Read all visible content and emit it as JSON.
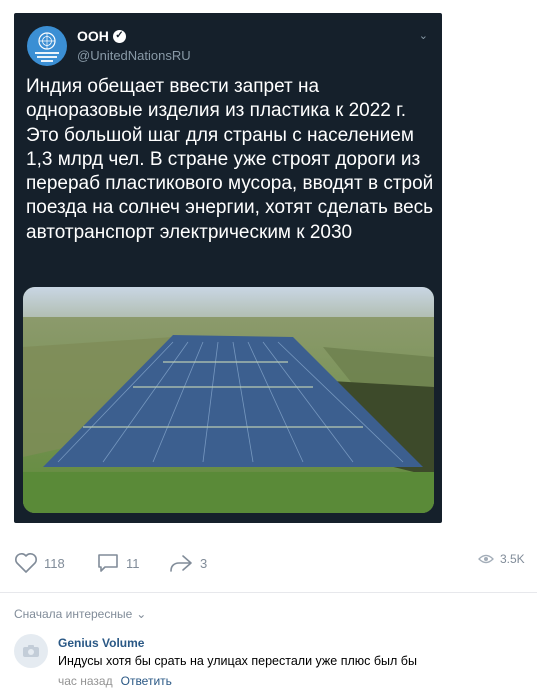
{
  "tweet": {
    "author_name": "ООН",
    "handle": "@UnitedNationsRU",
    "text": "Индия обещает ввести запрет на одноразовые изделия из пластика к 2022 г. Это большой шаг для страны с населением 1,3 млрд чел. В стране уже строят дороги из перераб пластикового мусора, вводят в строй поезда на солнеч энергии, хотят сделать весь автотранспорт электрическим к 2030",
    "avatar_text": "Организация Объединенных Наций"
  },
  "actions": {
    "likes": "118",
    "comments": "11",
    "shares": "3",
    "views": "3.5K"
  },
  "comments_section": {
    "sort_label": "Сначала интересные",
    "comment": {
      "author": "Genius Volume",
      "text": "Индусы хотя бы срать на улицах перестали уже плюс был бы",
      "time": "час назад",
      "reply_label": "Ответить"
    }
  },
  "colors": {
    "tweet_bg": "#15202b",
    "link": "#2a5885",
    "muted": "#818c99"
  }
}
